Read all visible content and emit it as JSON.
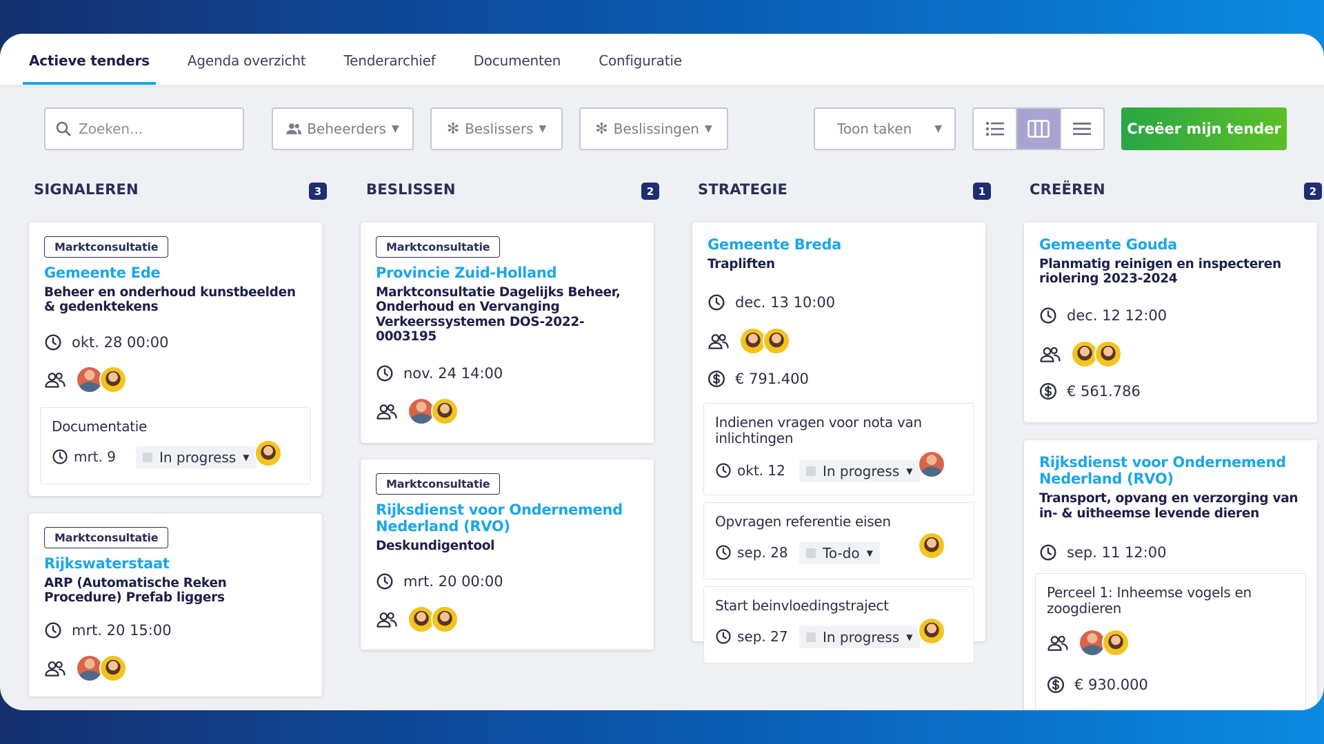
{
  "nav": {
    "tabs": [
      {
        "label": "Actieve tenders"
      },
      {
        "label": "Agenda overzicht"
      },
      {
        "label": "Tenderarchief"
      },
      {
        "label": "Documenten"
      },
      {
        "label": "Configuratie"
      }
    ]
  },
  "toolbar": {
    "search_placeholder": "Zoeken...",
    "filters": {
      "beheerders": "Beheerders",
      "beslissers": "Beslissers",
      "beslissingen": "Beslissingen"
    },
    "show_tasks": "Toon taken",
    "create_label": "Creëer mijn tender"
  },
  "columns": [
    {
      "title": "SIGNALEREN",
      "count": "3",
      "cards": [
        {
          "tag": "Marktconsultatie",
          "org": "Gemeente Ede",
          "title": "Beheer en onderhoud kunstbeelden & gedenktekens",
          "date": "okt. 28 00:00",
          "tasks": [
            {
              "title": "Documentatie",
              "date": "mrt. 9",
              "status": "In progress"
            }
          ]
        },
        {
          "tag": "Marktconsultatie",
          "org": "Rijkswaterstaat",
          "title": "ARP (Automatische Reken Procedure) Prefab liggers",
          "date": "mrt. 20 15:00"
        }
      ]
    },
    {
      "title": "BESLISSEN",
      "count": "2",
      "cards": [
        {
          "tag": "Marktconsultatie",
          "org": "Provincie Zuid-Holland",
          "title": "Marktconsultatie Dagelijks Beheer, Onderhoud en Vervanging Verkeerssystemen DOS-2022-0003195",
          "date": "nov. 24 14:00"
        },
        {
          "tag": "Marktconsultatie",
          "org": "Rijksdienst voor Ondernemend Nederland (RVO)",
          "title": "Deskundigentool",
          "date": "mrt. 20 00:00"
        }
      ]
    },
    {
      "title": "STRATEGIE",
      "count": "1",
      "cards": [
        {
          "org": "Gemeente Breda",
          "title": "Trapliften",
          "date": "dec. 13 10:00",
          "value": "€ 791.400",
          "tasks": [
            {
              "title": "Indienen vragen voor nota van inlichtingen",
              "date": "okt. 12",
              "status": "In progress"
            },
            {
              "title": "Opvragen referentie eisen",
              "date": "sep. 28",
              "status": "To-do"
            },
            {
              "title": "Start beinvloedingstraject",
              "date": "sep. 27",
              "status": "In progress"
            }
          ]
        }
      ]
    },
    {
      "title": "CREËREN",
      "count": "2",
      "cards": [
        {
          "org": "Gemeente Gouda",
          "title": "Planmatig reinigen en inspecteren riolering 2023-2024",
          "date": "dec. 12 12:00",
          "value": "€ 561.786"
        },
        {
          "org": "Rijksdienst voor Ondernemend Nederland (RVO)",
          "title": "Transport, opvang en verzorging van in- & uitheemse levende dieren",
          "date": "sep. 11 12:00",
          "lots": [
            {
              "title": "Perceel 1: Inheemse vogels en zoogdieren",
              "value": "€ 930.000"
            }
          ]
        }
      ]
    }
  ]
}
